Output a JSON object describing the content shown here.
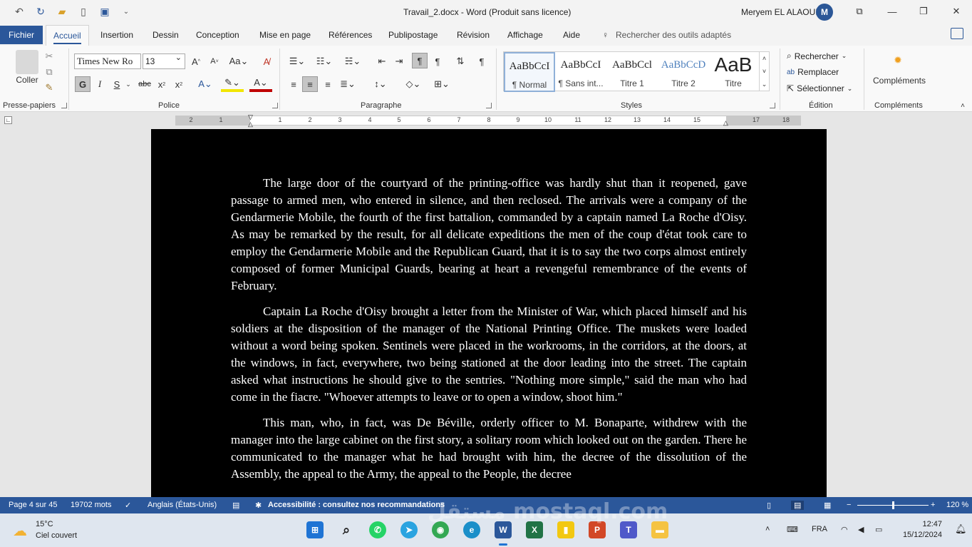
{
  "window": {
    "title": "Travail_2.docx  -  Word (Produit sans licence)",
    "user_name": "Meryem EL ALAOUI",
    "user_initial": "M"
  },
  "tabs": [
    "Fichier",
    "Accueil",
    "Insertion",
    "Dessin",
    "Conception",
    "Mise en page",
    "Références",
    "Publipostage",
    "Révision",
    "Affichage",
    "Aide"
  ],
  "tell_me": "Rechercher des outils adaptés",
  "ribbon": {
    "clipboard": {
      "paste": "Coller",
      "label": "Presse-papiers"
    },
    "font": {
      "name": "Times New Ro",
      "size": "13",
      "label": "Police",
      "bold": "G",
      "italic": "I",
      "underline": "S"
    },
    "paragraph": {
      "label": "Paragraphe"
    },
    "styles": {
      "label": "Styles",
      "items": [
        {
          "sample": "AaBbCcI",
          "name": "¶ Normal"
        },
        {
          "sample": "AaBbCcI",
          "name": "¶ Sans int..."
        },
        {
          "sample": "AaBbCcl",
          "name": "Titre 1"
        },
        {
          "sample": "AaBbCcD",
          "name": "Titre 2"
        },
        {
          "sample": "AaB",
          "name": "Titre"
        }
      ]
    },
    "editing": {
      "label": "Édition",
      "find": "Rechercher",
      "replace": "Remplacer",
      "select": "Sélectionner"
    },
    "addins": {
      "button": "Compléments",
      "label": "Compléments"
    }
  },
  "ruler": [
    "2",
    "1",
    "1",
    "2",
    "3",
    "4",
    "5",
    "6",
    "7",
    "8",
    "9",
    "10",
    "11",
    "12",
    "13",
    "14",
    "15",
    "17",
    "18"
  ],
  "document": {
    "p1": "The large door of the courtyard of the printing-office was hardly shut than it reopened, gave passage to armed men, who entered in silence, and then reclosed. The arrivals were a company of the Gendarmerie Mobile, the fourth of the first battalion, commanded by a captain named La Roche d'Oisy. As may be remarked by the result, for all delicate expeditions the men of the coup d'état took care to employ the Gendarmerie Mobile and the Republican Guard, that it is to say the two corps almost entirely composed of former Municipal Guards, bearing at heart a revengeful remembrance of the events of February.",
    "p2": "Captain La Roche d'Oisy brought a letter from the Minister of War, which placed himself and his soldiers at the disposition of the manager of the National Printing Office. The muskets were loaded without a word being spoken. Sentinels were placed in the workrooms, in the corridors, at the doors, at the windows, in fact, everywhere, two being stationed at the door leading into the street. The captain asked what instructions he should give to the sentries. \"Nothing more simple,\" said the man who had come in the fiacre. \"Whoever attempts to leave or to open a window, shoot him.\"",
    "p3": "This man, who, in fact, was De Béville, orderly officer to M. Bonaparte, withdrew with the manager into the large cabinet on the first story, a solitary room which looked out on the garden. There he communicated to the manager what he had brought with him, the decree of the dissolution of the Assembly, the appeal to the Army, the appeal to the People, the decree"
  },
  "status": {
    "page": "Page 4 sur 45",
    "words": "19702 mots",
    "language": "Anglais (États-Unis)",
    "accessibility": "Accessibilité : consultez nos recommandations",
    "zoom": "120 %"
  },
  "taskbar": {
    "temperature": "15°C",
    "weather": "Ciel couvert",
    "lang": "FRA",
    "time": "12:47",
    "date": "15/12/2024",
    "watermark": "مستقل mostaql.com"
  }
}
